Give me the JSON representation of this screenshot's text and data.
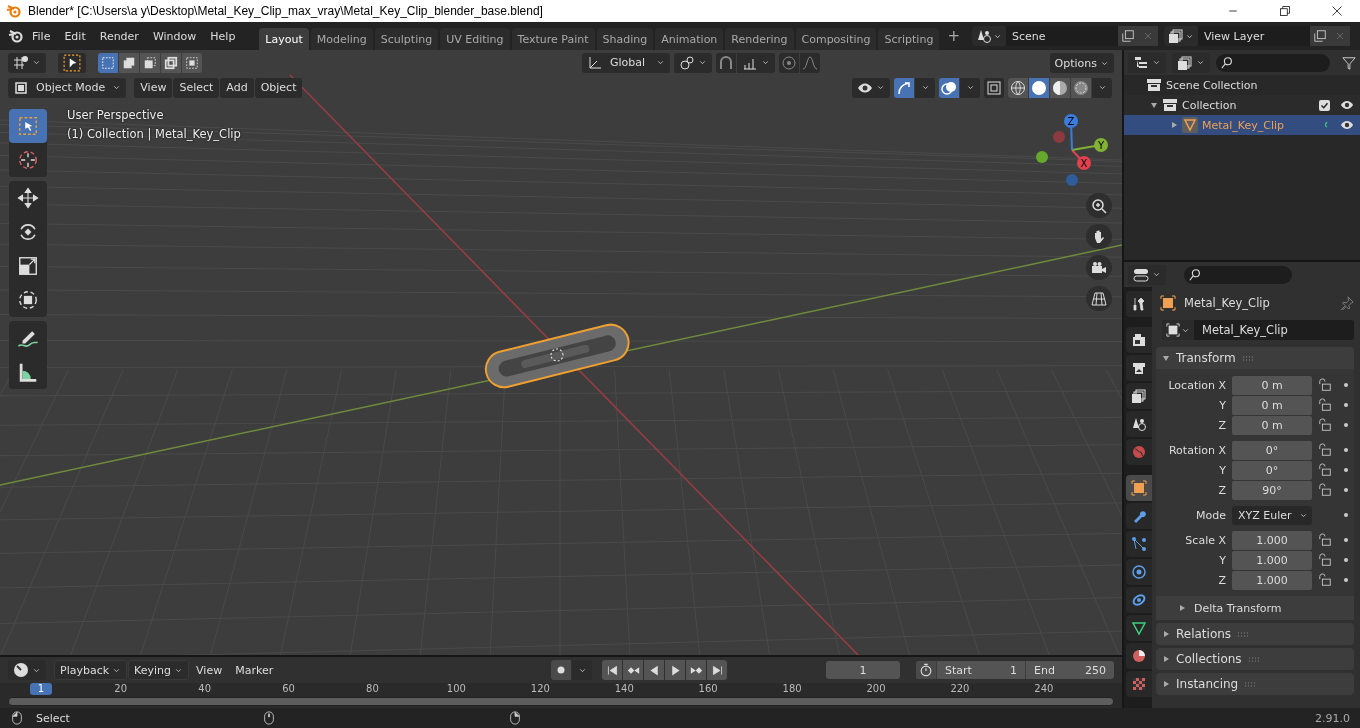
{
  "title_bar": {
    "title": "Blender* [C:\\Users\\a y\\Desktop\\Metal_Key_Clip_max_vray\\Metal_Key_Clip_blender_base.blend]"
  },
  "top_bar": {
    "menus": [
      "File",
      "Edit",
      "Render",
      "Window",
      "Help"
    ],
    "workspaces": [
      {
        "label": "Layout",
        "selected": true
      },
      {
        "label": "Modeling",
        "selected": false
      },
      {
        "label": "Sculpting",
        "selected": false
      },
      {
        "label": "UV Editing",
        "selected": false
      },
      {
        "label": "Texture Paint",
        "selected": false
      },
      {
        "label": "Shading",
        "selected": false
      },
      {
        "label": "Animation",
        "selected": false
      },
      {
        "label": "Rendering",
        "selected": false
      },
      {
        "label": "Compositing",
        "selected": false
      },
      {
        "label": "Scripting",
        "selected": false
      }
    ],
    "add_workspace": "+",
    "scene": "Scene",
    "view_layer": "View Layer"
  },
  "tool_header": {
    "select_modes": [
      {
        "selected": true
      },
      {
        "selected": false
      },
      {
        "selected": false
      },
      {
        "selected": false
      },
      {
        "selected": false
      }
    ],
    "orientation": "Global",
    "options": "Options"
  },
  "viewport_header": {
    "mode": "Object Mode",
    "menus": [
      "View",
      "Select",
      "Add",
      "Object"
    ],
    "shading_modes": [
      {
        "selected": false
      },
      {
        "selected": true
      },
      {
        "selected": false
      },
      {
        "selected": false
      }
    ]
  },
  "viewport": {
    "info": [
      "User Perspective",
      "(1) Collection | Metal_Key_Clip"
    ],
    "tools": [
      {
        "kind": "select",
        "selected": true
      },
      {
        "kind": "cursor",
        "selected": false
      },
      {
        "kind": "move",
        "selected": false
      },
      {
        "kind": "rotate",
        "selected": false
      },
      {
        "kind": "scale",
        "selected": false
      },
      {
        "kind": "transform",
        "selected": false
      },
      {
        "kind": "annotate",
        "selected": false
      },
      {
        "kind": "measure",
        "selected": false
      }
    ],
    "gizmo_axes": [
      "X",
      "Y",
      "Z"
    ]
  },
  "outliner": {
    "items": [
      {
        "label": "Scene Collection",
        "selected": false,
        "children": [
          {
            "label": "Collection",
            "selected": false,
            "checked": true,
            "children": [
              {
                "label": "Metal_Key_Clip",
                "selected": true
              }
            ]
          }
        ]
      }
    ]
  },
  "properties": {
    "tabs": [
      {
        "kind": "tool",
        "selected": false
      },
      {
        "kind": "render",
        "selected": false
      },
      {
        "kind": "output",
        "selected": false
      },
      {
        "kind": "view_layer",
        "selected": false
      },
      {
        "kind": "scene",
        "selected": false
      },
      {
        "kind": "world",
        "selected": false
      },
      {
        "kind": "object",
        "selected": true
      },
      {
        "kind": "modifiers",
        "selected": false
      },
      {
        "kind": "particles",
        "selected": false
      },
      {
        "kind": "physics",
        "selected": false
      },
      {
        "kind": "constraints",
        "selected": false
      },
      {
        "kind": "data",
        "selected": false
      },
      {
        "kind": "material",
        "selected": false
      },
      {
        "kind": "texture",
        "selected": false
      }
    ],
    "object_name": "Metal_Key_Clip",
    "datablock": "Metal_Key_Clip",
    "panels": [
      {
        "title": "Transform",
        "expanded": true,
        "fields": [
          {
            "kind": "number",
            "label": "Location X",
            "value": "0 m"
          },
          {
            "kind": "number",
            "label": "Y",
            "value": "0 m"
          },
          {
            "kind": "number",
            "label": "Z",
            "value": "0 m"
          },
          {
            "kind": "number",
            "label": "Rotation X",
            "value": "0°"
          },
          {
            "kind": "number",
            "label": "Y",
            "value": "0°"
          },
          {
            "kind": "number",
            "label": "Z",
            "value": "90°"
          },
          {
            "kind": "dropdown",
            "label": "Mode",
            "value": "XYZ Euler"
          },
          {
            "kind": "number",
            "label": "Scale X",
            "value": "1.000"
          },
          {
            "kind": "number",
            "label": "Y",
            "value": "1.000"
          },
          {
            "kind": "number",
            "label": "Z",
            "value": "1.000"
          }
        ],
        "subpanels": [
          {
            "title": "Delta Transform",
            "expanded": false
          }
        ]
      },
      {
        "title": "Relations",
        "expanded": false
      },
      {
        "title": "Collections",
        "expanded": false
      },
      {
        "title": "Instancing",
        "expanded": false
      }
    ]
  },
  "timeline": {
    "menus": [
      "Playback",
      "Keying",
      "View",
      "Marker"
    ],
    "current_frame": "1",
    "start_label": "Start",
    "start": "1",
    "end_label": "End",
    "end": "250",
    "ruler": [
      "1",
      "20",
      "40",
      "60",
      "80",
      "100",
      "120",
      "140",
      "160",
      "180",
      "200",
      "220",
      "240"
    ]
  },
  "status_bar": {
    "hint": "Select",
    "version": "2.91.0"
  }
}
